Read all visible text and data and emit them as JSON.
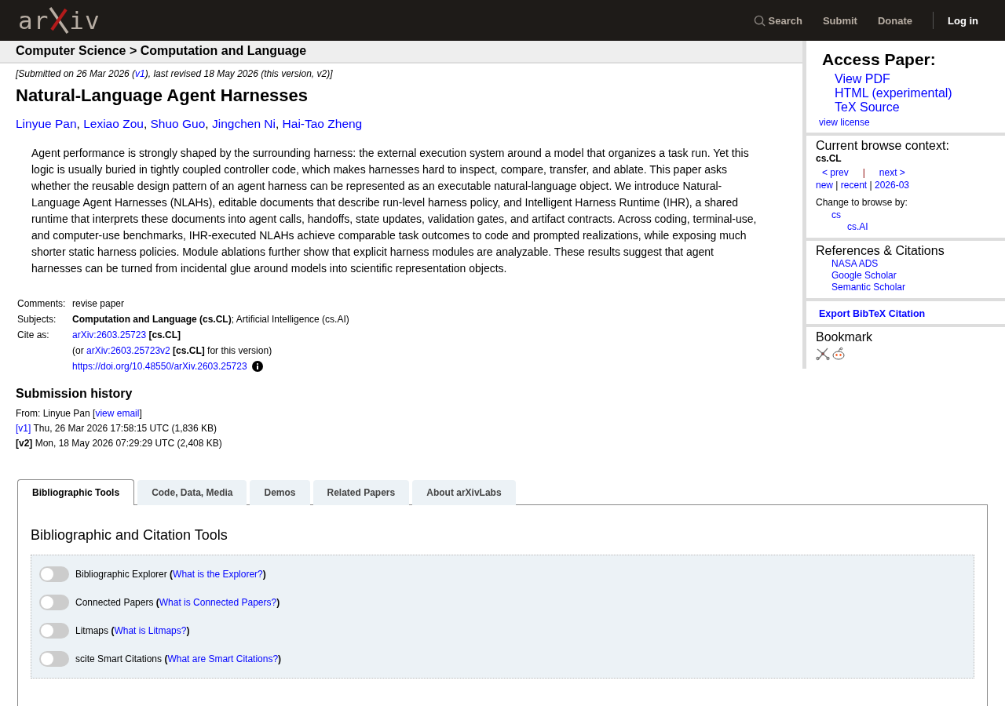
{
  "header": {
    "logo": {
      "left": "ar",
      "right": "iv"
    },
    "nav": [
      {
        "kind": "search",
        "label": "Search"
      },
      {
        "kind": "link",
        "label": "Submit"
      },
      {
        "kind": "link",
        "label": "Donate"
      },
      {
        "kind": "login",
        "label": "Log in"
      }
    ]
  },
  "breadcrumb": "Computer Science > Computation and Language",
  "submitted": [
    {
      "kind": "text",
      "text": "[Submitted on 26 Mar 2026 ("
    },
    {
      "kind": "link",
      "text": "v1"
    },
    {
      "kind": "text",
      "text": "), last revised 18 May 2026 (this version, v2)]"
    }
  ],
  "title": "Natural-Language Agent Harnesses",
  "authors": {
    "separator": ", ",
    "names": [
      "Linyue Pan",
      "Lexiao Zou",
      "Shuo Guo",
      "Jingchen Ni",
      "Hai-Tao Zheng"
    ]
  },
  "abstract": "Agent performance is strongly shaped by the surrounding harness: the external execution system around a model that organizes a task run. Yet this logic is usually buried in tightly coupled controller code, which makes harnesses hard to inspect, compare, transfer, and ablate. This paper asks whether the reusable design pattern of an agent harness can be represented as an executable natural-language object. We introduce Natural-Language Agent Harnesses (NLAHs), editable documents that describe run-level harness policy, and Intelligent Harness Runtime (IHR), a shared runtime that interprets these documents into agent calls, handoffs, state updates, validation gates, and artifact contracts. Across coding, terminal-use, and computer-use benchmarks, IHR-executed NLAHs achieve comparable task outcomes to code and prompted realizations, while exposing much shorter static harness policies. Module ablations further show that explicit harness modules are analyzable. These results suggest that agent harnesses can be turned from incidental glue around models into scientific representation objects.",
  "metadata": [
    {
      "label": "Comments:",
      "lines": [
        {
          "parts": [
            {
              "kind": "text",
              "text": "revise paper"
            }
          ]
        }
      ]
    },
    {
      "label": "Subjects:",
      "lines": [
        {
          "parts": [
            {
              "kind": "bold",
              "text": "Computation and Language (cs.CL)"
            },
            {
              "kind": "text",
              "text": "; Artificial Intelligence (cs.AI)"
            }
          ]
        }
      ]
    },
    {
      "label": "Cite as:",
      "lines": [
        {
          "parts": [
            {
              "kind": "link",
              "text": "arXiv:2603.25723"
            },
            {
              "kind": "bold",
              "text": " [cs.CL]"
            }
          ]
        },
        {
          "parts": [
            {
              "kind": "text",
              "text": "(or "
            },
            {
              "kind": "link",
              "text": "arXiv:2603.25723v2"
            },
            {
              "kind": "bold",
              "text": " [cs.CL]"
            },
            {
              "kind": "text",
              "text": " for this version)"
            }
          ]
        },
        {
          "parts": [
            {
              "kind": "link",
              "text": "https://doi.org/10.48550/arXiv.2603.25723"
            },
            {
              "kind": "info"
            }
          ]
        }
      ]
    }
  ],
  "history": {
    "title": "Submission history",
    "lines": [
      {
        "parts": [
          {
            "kind": "text",
            "text": "From: Linyue Pan ["
          },
          {
            "kind": "link",
            "text": "view email"
          },
          {
            "kind": "text",
            "text": "]"
          }
        ]
      },
      {
        "parts": [
          {
            "kind": "link",
            "text": "[v1]"
          },
          {
            "kind": "text",
            "text": " Thu, 26 Mar 2026 17:58:15 UTC (1,836 KB)"
          }
        ]
      },
      {
        "parts": [
          {
            "kind": "bold",
            "text": "[v2]"
          },
          {
            "kind": "text",
            "text": " Mon, 18 May 2026 07:29:29 UTC (2,408 KB)"
          }
        ]
      }
    ]
  },
  "tabs": [
    {
      "label": "Bibliographic Tools",
      "selected": true
    },
    {
      "label": "Code, Data, Media",
      "selected": false
    },
    {
      "label": "Demos",
      "selected": false
    },
    {
      "label": "Related Papers",
      "selected": false
    },
    {
      "label": "About arXivLabs",
      "selected": false
    }
  ],
  "tools": {
    "title": "Bibliographic and Citation Tools",
    "open": "(",
    "close": ")",
    "items": [
      {
        "name": "Bibliographic Explorer",
        "help": "What is the Explorer?",
        "on": false
      },
      {
        "name": "Connected Papers",
        "help": "What is Connected Papers?",
        "on": false
      },
      {
        "name": "Litmaps",
        "help": "What is Litmaps?",
        "on": false
      },
      {
        "name": "scite Smart Citations",
        "help": "What are Smart Citations?",
        "on": false
      }
    ]
  },
  "sidebar": {
    "access": {
      "title": "Access Paper:",
      "links": [
        "View PDF",
        "HTML (experimental)",
        "TeX Source"
      ],
      "license": "view license"
    },
    "context": {
      "title": "Current browse context:",
      "current": "cs.CL",
      "prev": "< prev",
      "divider": "|",
      "next": "next >",
      "nav": [
        {
          "kind": "link",
          "text": "new"
        },
        {
          "kind": "text",
          "text": " | "
        },
        {
          "kind": "link",
          "text": "recent"
        },
        {
          "kind": "text",
          "text": " | "
        },
        {
          "kind": "link",
          "text": "2026-03"
        }
      ],
      "change_label": "Change to browse by:",
      "browse": [
        {
          "label": "cs",
          "children": [
            {
              "label": "cs.AI"
            }
          ]
        }
      ]
    },
    "references": {
      "title": "References & Citations",
      "links": [
        "NASA ADS",
        "Google Scholar",
        "Semantic Scholar"
      ]
    },
    "export": "Export BibTeX Citation",
    "bookmark": {
      "title": "Bookmark"
    }
  }
}
